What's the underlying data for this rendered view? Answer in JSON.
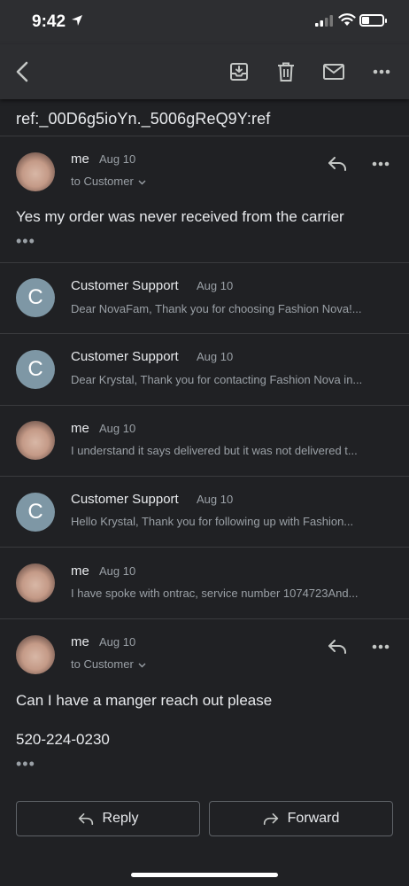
{
  "status_bar": {
    "time": "9:42"
  },
  "toolbar": {
    "back": "back-arrow-icon",
    "archive": "archive-icon",
    "delete": "trash-icon",
    "mark_unread": "mail-icon",
    "more": "more-icon"
  },
  "subject": "ref:_00D6g5ioYn._5006gReQ9Y:ref",
  "messages": [
    {
      "sender": "me",
      "date": "Aug 10",
      "to": "to Customer",
      "body": "Yes my order was never received from the carrier",
      "expanded": true
    },
    {
      "sender": "Customer Support",
      "date": "Aug 10",
      "avatar_letter": "C",
      "snippet": "Dear NovaFam, Thank you for choosing Fashion Nova!..."
    },
    {
      "sender": "Customer Support",
      "date": "Aug 10",
      "avatar_letter": "C",
      "snippet": "Dear Krystal, Thank you for contacting Fashion Nova in..."
    },
    {
      "sender": "me",
      "date": "Aug 10",
      "snippet": "I understand it says delivered but it was not delivered t..."
    },
    {
      "sender": "Customer Support",
      "date": "Aug 10",
      "avatar_letter": "C",
      "snippet": "Hello Krystal, Thank you for following up with Fashion..."
    },
    {
      "sender": "me",
      "date": "Aug 10",
      "snippet": "I have spoke with ontrac, service number 1074723And..."
    },
    {
      "sender": "me",
      "date": "Aug 10",
      "to": "to Customer",
      "body_lines": [
        "Can I have a manger reach out please",
        "520-224-0230"
      ],
      "expanded": true
    }
  ],
  "actions": {
    "reply": "Reply",
    "forward": "Forward"
  },
  "colors": {
    "background": "#202124",
    "toolbar": "#2d2e31",
    "avatar_c": "#7e97a5",
    "secondary_text": "#9aa0a6"
  }
}
